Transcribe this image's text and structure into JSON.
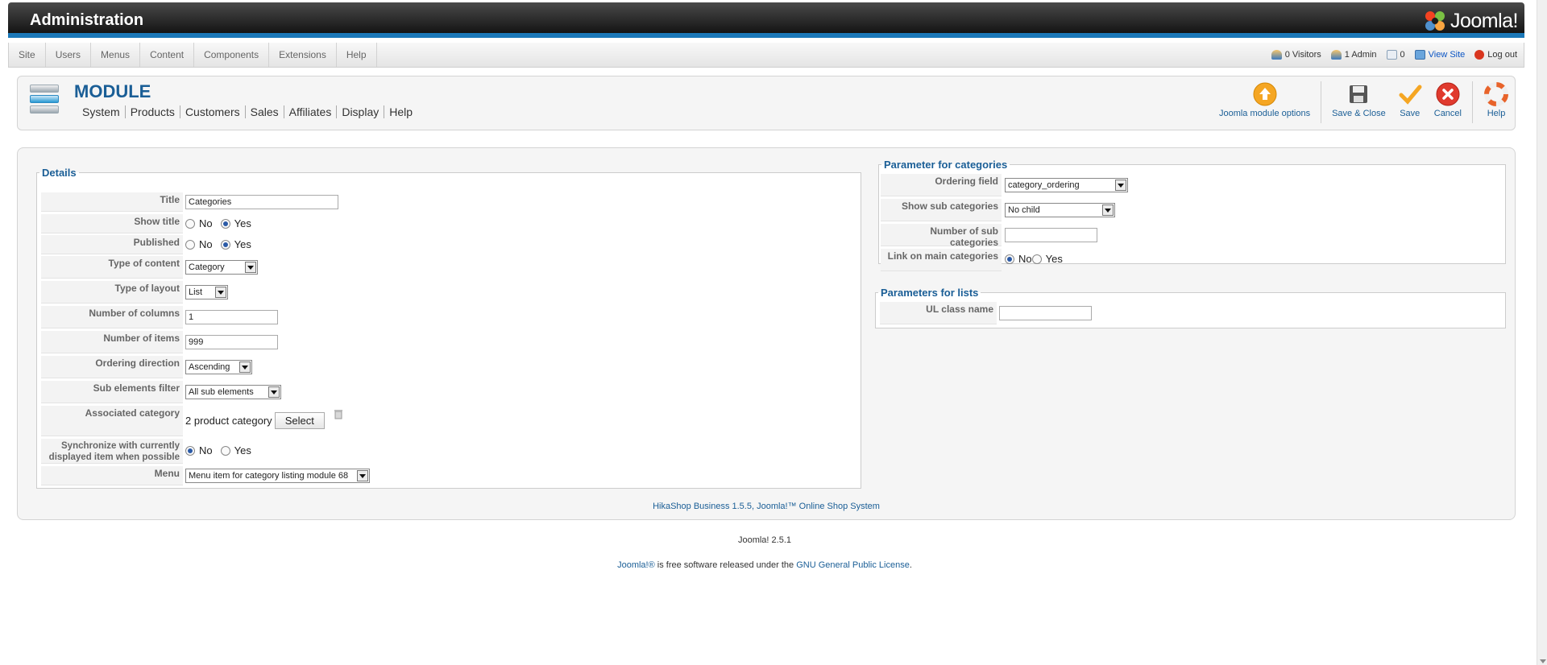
{
  "header": {
    "title": "Administration",
    "logo_text": "Joomla!"
  },
  "menubar": {
    "items": [
      "Site",
      "Users",
      "Menus",
      "Content",
      "Components",
      "Extensions",
      "Help"
    ],
    "status": {
      "visitors": "0 Visitors",
      "admins": "1 Admin",
      "messages": "0",
      "view_site": "View Site",
      "logout": "Log out"
    }
  },
  "toolbar": {
    "page_title": "MODULE",
    "submenu": [
      "System",
      "Products",
      "Customers",
      "Sales",
      "Affiliates",
      "Display",
      "Help"
    ],
    "buttons": {
      "options": "Joomla module options",
      "save_close": "Save & Close",
      "save": "Save",
      "cancel": "Cancel",
      "help": "Help"
    }
  },
  "details": {
    "legend": "Details",
    "labels": {
      "title": "Title",
      "show_title": "Show title",
      "published": "Published",
      "type_of_content": "Type of content",
      "type_of_layout": "Type of layout",
      "number_of_columns": "Number of columns",
      "number_of_items": "Number of items",
      "ordering_direction": "Ordering direction",
      "sub_elements_filter": "Sub elements filter",
      "associated_category": "Associated category",
      "synchronize": "Synchronize with currently displayed item when possible",
      "menu": "Menu"
    },
    "values": {
      "title": "Categories",
      "type_of_content": "Category",
      "type_of_layout": "List",
      "number_of_columns": "1",
      "number_of_items": "999",
      "ordering_direction": "Ascending",
      "sub_elements_filter": "All sub elements",
      "associated_category": "2 product category",
      "select_button": "Select",
      "menu": "Menu item for category listing module 68"
    },
    "no": "No",
    "yes": "Yes"
  },
  "cat_params": {
    "legend": "Parameter for categories",
    "labels": {
      "ordering_field": "Ordering field",
      "show_sub_categories": "Show sub categories",
      "number_of_sub_categories": "Number of sub categories",
      "link_on_main": "Link on main categories"
    },
    "values": {
      "ordering_field": "category_ordering",
      "show_sub_categories": "No child",
      "number_of_sub_categories": ""
    }
  },
  "list_params": {
    "legend": "Parameters for lists",
    "labels": {
      "ul_class": "UL class name"
    },
    "values": {
      "ul_class": ""
    }
  },
  "footer": {
    "hikashop": "HikaShop Business 1.5.5, Joomla!™ Online Shop System",
    "version": "Joomla! 2.5.1",
    "license_prefix": "Joomla!®",
    "license_middle": " is free software released under the ",
    "license_link": "GNU General Public License",
    "license_suffix": "."
  },
  "colors": {
    "accent": "#1a5e96",
    "header_bar": "#1b78b8",
    "cancel": "#e03a2e",
    "save": "#f5a623"
  }
}
